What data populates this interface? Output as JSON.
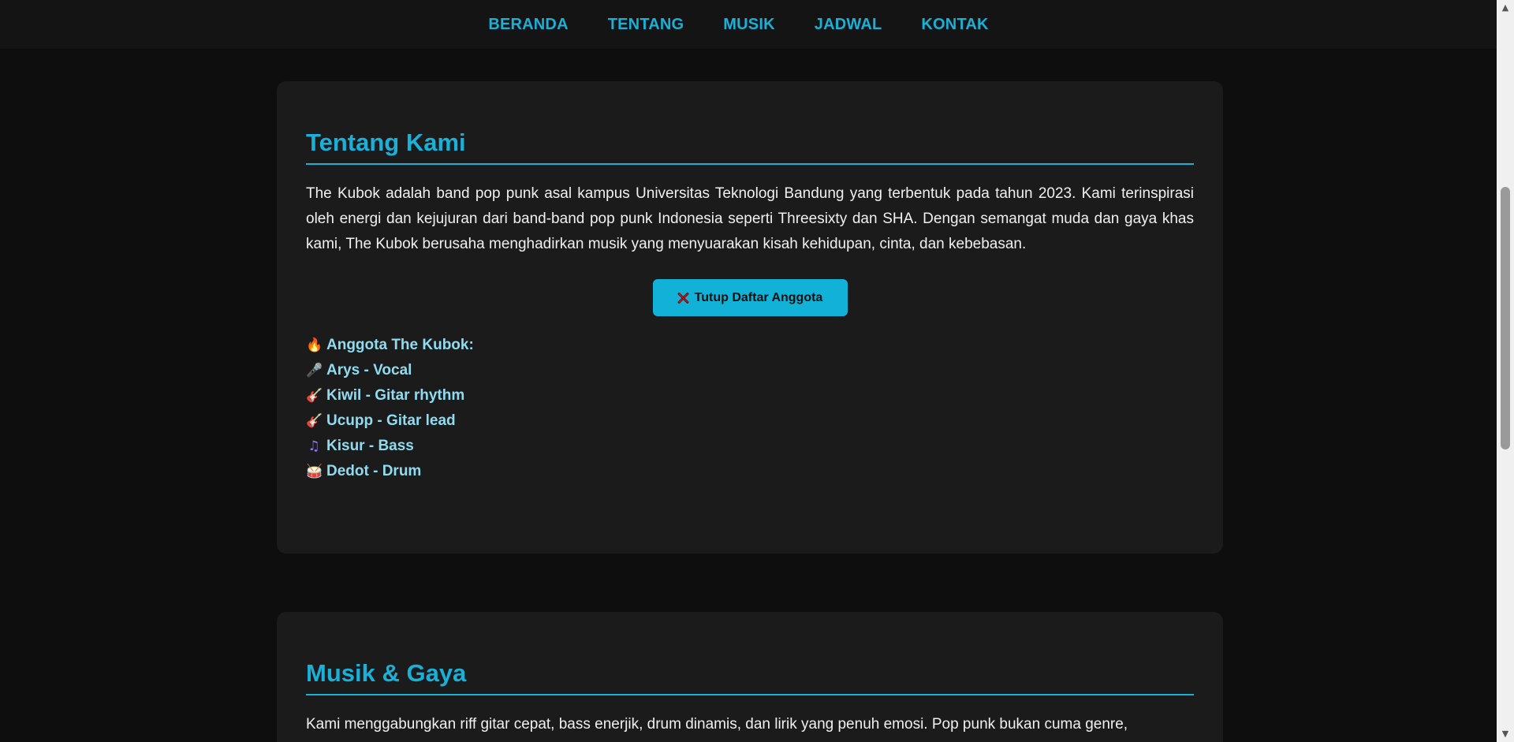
{
  "nav": {
    "items": [
      "BERANDA",
      "TENTANG",
      "MUSIK",
      "JADWAL",
      "KONTAK"
    ]
  },
  "about": {
    "title": "Tentang Kami",
    "paragraph": "The Kubok adalah band pop punk asal kampus Universitas Teknologi Bandung yang terbentuk pada tahun 2023. Kami terinspirasi oleh energi dan kejujuran dari band-band pop punk Indonesia seperti Threesixty dan SHA. Dengan semangat muda dan gaya khas kami, The Kubok berusaha menghadirkan musik yang menyuarakan kisah kehidupan, cinta, dan kebebasan.",
    "toggle_button": "Tutup Daftar Anggota",
    "toggle_icon": "x-icon",
    "members_heading": "Anggota The Kubok:",
    "members": [
      {
        "icon": "microphone-icon",
        "text": "Arys - Vocal"
      },
      {
        "icon": "guitar-icon",
        "text": "Kiwil - Gitar rhythm"
      },
      {
        "icon": "guitar-icon",
        "text": "Ucupp - Gitar lead"
      },
      {
        "icon": "music-note-icon",
        "text": "Kisur - Bass"
      },
      {
        "icon": "drum-icon",
        "text": "Dedot - Drum"
      }
    ]
  },
  "music": {
    "title": "Musik & Gaya",
    "paragraph": "Kami menggabungkan riff gitar cepat, bass enerjik, drum dinamis, dan lirik yang penuh emosi. Pop punk bukan cuma genre,"
  },
  "colors": {
    "accent": "#1ab0d8",
    "background": "#0e0e0e",
    "card": "#1b1b1b",
    "member_text": "#8fdcf0"
  }
}
